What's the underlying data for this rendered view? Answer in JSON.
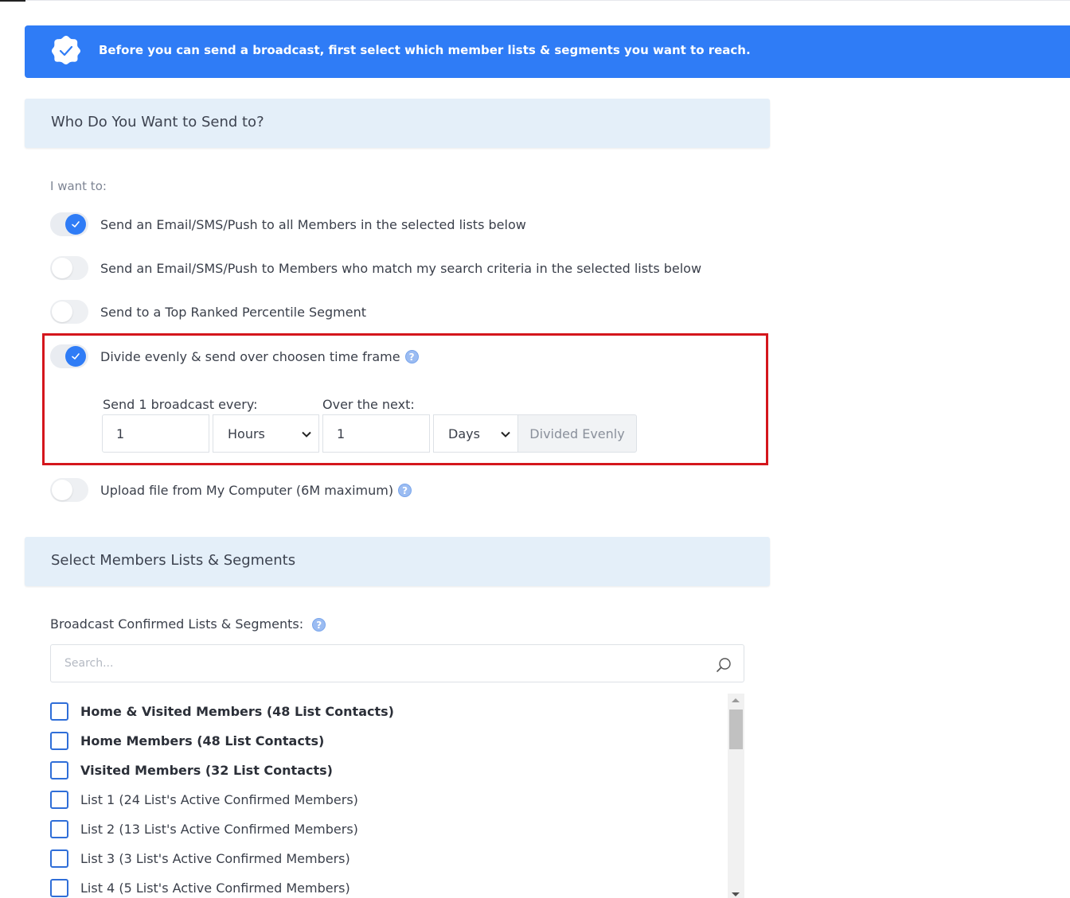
{
  "banner": {
    "text": "Before you can send a broadcast, first select which member lists & segments you want to reach.",
    "icon": "verified-badge-icon",
    "color": "#2f7cf6"
  },
  "section1": {
    "title": "Who Do You Want to Send to?"
  },
  "options": {
    "intro": "I want to:",
    "items": [
      {
        "label": "Send an Email/SMS/Push to all Members in the selected lists below",
        "checked": true
      },
      {
        "label": "Send an Email/SMS/Push to Members who match my search criteria in the selected lists below",
        "checked": false
      },
      {
        "label": "Send to a Top Ranked Percentile Segment",
        "checked": false
      },
      {
        "label": "Divide evenly & send over choosen time frame",
        "checked": true,
        "help": "?"
      },
      {
        "label": "Upload file from My Computer (6M maximum)",
        "checked": false,
        "help": "?"
      }
    ]
  },
  "schedule": {
    "every_label": "Send 1 broadcast every:",
    "every_value": "1",
    "every_unit": "Hours",
    "over_label": "Over the next:",
    "over_value": "1",
    "over_unit": "Days",
    "addon": "Divided Evenly"
  },
  "section2": {
    "title": "Select Members Lists & Segments"
  },
  "lists": {
    "label": "Broadcast Confirmed Lists & Segments:",
    "help": "?",
    "search_placeholder": "Search...",
    "items": [
      {
        "label": "Home & Visited Members (48 List Contacts)",
        "bold": true
      },
      {
        "label": "Home Members (48 List Contacts)",
        "bold": true
      },
      {
        "label": "Visited Members (32 List Contacts)",
        "bold": true
      },
      {
        "label": "List 1 (24 List's Active Confirmed Members)",
        "bold": false
      },
      {
        "label": "List 2 (13 List's Active Confirmed Members)",
        "bold": false
      },
      {
        "label": "List 3 (3 List's Active Confirmed Members)",
        "bold": false
      },
      {
        "label": "List 4 (5 List's Active Confirmed Members)",
        "bold": false
      }
    ]
  }
}
